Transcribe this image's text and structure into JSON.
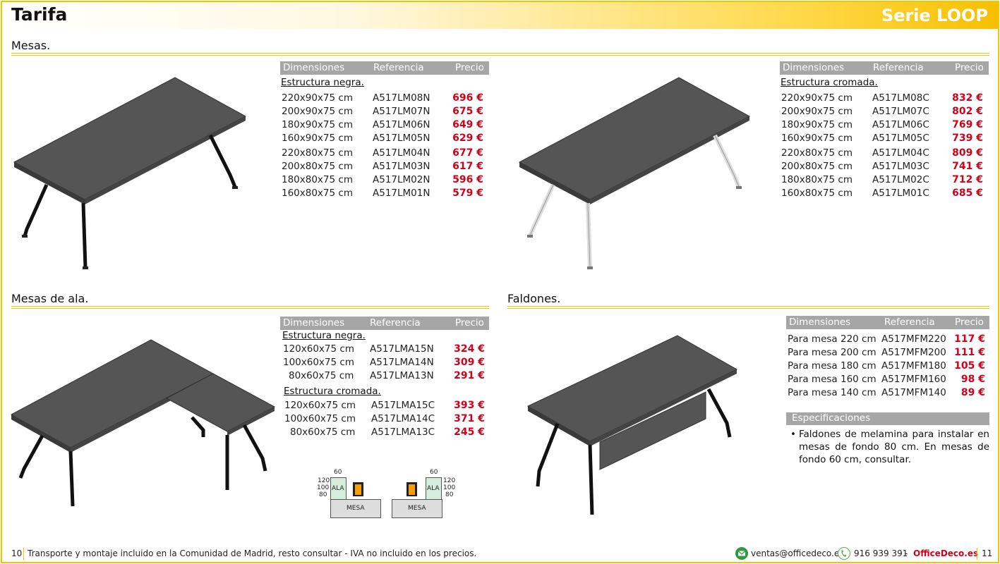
{
  "header": {
    "title": "Tarifa",
    "serie": "Serie LOOP"
  },
  "columns": {
    "dim": "Dimensiones",
    "ref": "Referencia",
    "price": "Precio"
  },
  "mesas": {
    "title": "Mesas.",
    "negra": {
      "label": "Estructura negra.",
      "rows": [
        {
          "dim": "220x90x75 cm",
          "ref": "A517LM08N",
          "price": "696 €"
        },
        {
          "dim": "200x90x75 cm",
          "ref": "A517LM07N",
          "price": "675 €"
        },
        {
          "dim": "180x90x75 cm",
          "ref": "A517LM06N",
          "price": "649 €"
        },
        {
          "dim": "160x90x75 cm",
          "ref": "A517LM05N",
          "price": "629 €"
        },
        {
          "dim": "220x80x75 cm",
          "ref": "A517LM04N",
          "price": "677 €"
        },
        {
          "dim": "200x80x75 cm",
          "ref": "A517LM03N",
          "price": "617 €"
        },
        {
          "dim": "180x80x75 cm",
          "ref": "A517LM02N",
          "price": "596 €"
        },
        {
          "dim": "160x80x75 cm",
          "ref": "A517LM01N",
          "price": "579 €"
        }
      ]
    },
    "cromada": {
      "label": "Estructura cromada.",
      "rows": [
        {
          "dim": "220x90x75 cm",
          "ref": "A517LM08C",
          "price": "832 €"
        },
        {
          "dim": "200x90x75 cm",
          "ref": "A517LM07C",
          "price": "802 €"
        },
        {
          "dim": "180x90x75 cm",
          "ref": "A517LM06C",
          "price": "769 €"
        },
        {
          "dim": "160x90x75 cm",
          "ref": "A517LM05C",
          "price": "739 €"
        },
        {
          "dim": "220x80x75 cm",
          "ref": "A517LM04C",
          "price": "809 €"
        },
        {
          "dim": "200x80x75 cm",
          "ref": "A517LM03C",
          "price": "741 €"
        },
        {
          "dim": "180x80x75 cm",
          "ref": "A517LM02C",
          "price": "712 €"
        },
        {
          "dim": "160x80x75 cm",
          "ref": "A517LM01C",
          "price": "685 €"
        }
      ]
    }
  },
  "ala": {
    "title": "Mesas de ala.",
    "negra": {
      "label": "Estructura negra.",
      "rows": [
        {
          "dim": "120x60x75 cm",
          "ref": "A517LMA15N",
          "price": "324 €"
        },
        {
          "dim": "100x60x75 cm",
          "ref": "A517LMA14N",
          "price": "309 €"
        },
        {
          "dim": "80x60x75 cm",
          "ref": "A517LMA13N",
          "price": "291 €"
        }
      ]
    },
    "cromada": {
      "label": "Estructura cromada.",
      "rows": [
        {
          "dim": "120x60x75 cm",
          "ref": "A517LMA15C",
          "price": "393 €"
        },
        {
          "dim": "100x60x75 cm",
          "ref": "A517LMA14C",
          "price": "371 €"
        },
        {
          "dim": "80x60x75 cm",
          "ref": "A517LMA13C",
          "price": "245 €"
        }
      ]
    },
    "diagram": {
      "top": "60",
      "sizes": [
        "120",
        "100",
        "80"
      ],
      "ala": "ALA",
      "mesa": "MESA"
    }
  },
  "faldones": {
    "title": "Faldones.",
    "rows": [
      {
        "dim": "Para mesa 220 cm",
        "ref": "A517MFM220",
        "price": "117 €"
      },
      {
        "dim": "Para mesa 200 cm",
        "ref": "A517MFM200",
        "price": "111 €"
      },
      {
        "dim": "Para mesa 180 cm",
        "ref": "A517MFM180",
        "price": "105 €"
      },
      {
        "dim": "Para mesa 160 cm",
        "ref": "A517MFM160",
        "price": "98 €"
      },
      {
        "dim": "Para mesa 140 cm",
        "ref": "A517MFM140",
        "price": "89 €"
      }
    ],
    "spec_title": "Especificaciones",
    "spec_text": "Faldones de melamina para instalar en mesas de fondo 80 cm. En mesas de fondo 60 cm, consultar."
  },
  "footer": {
    "page_left": "10",
    "note": "Transporte y montaje incluido en la Comunidad de Madrid, resto consultar - IVA no incluido en los precios.",
    "email": "ventas@officedeco.es",
    "phone": "916 939 391",
    "dash": "-",
    "brand": "OfficeDeco.es",
    "page_right": "11"
  },
  "colors": {
    "accent": "#f2c500",
    "price": "#d0021b",
    "table_head": "#a6a6a6",
    "desk_top": "#555555"
  }
}
